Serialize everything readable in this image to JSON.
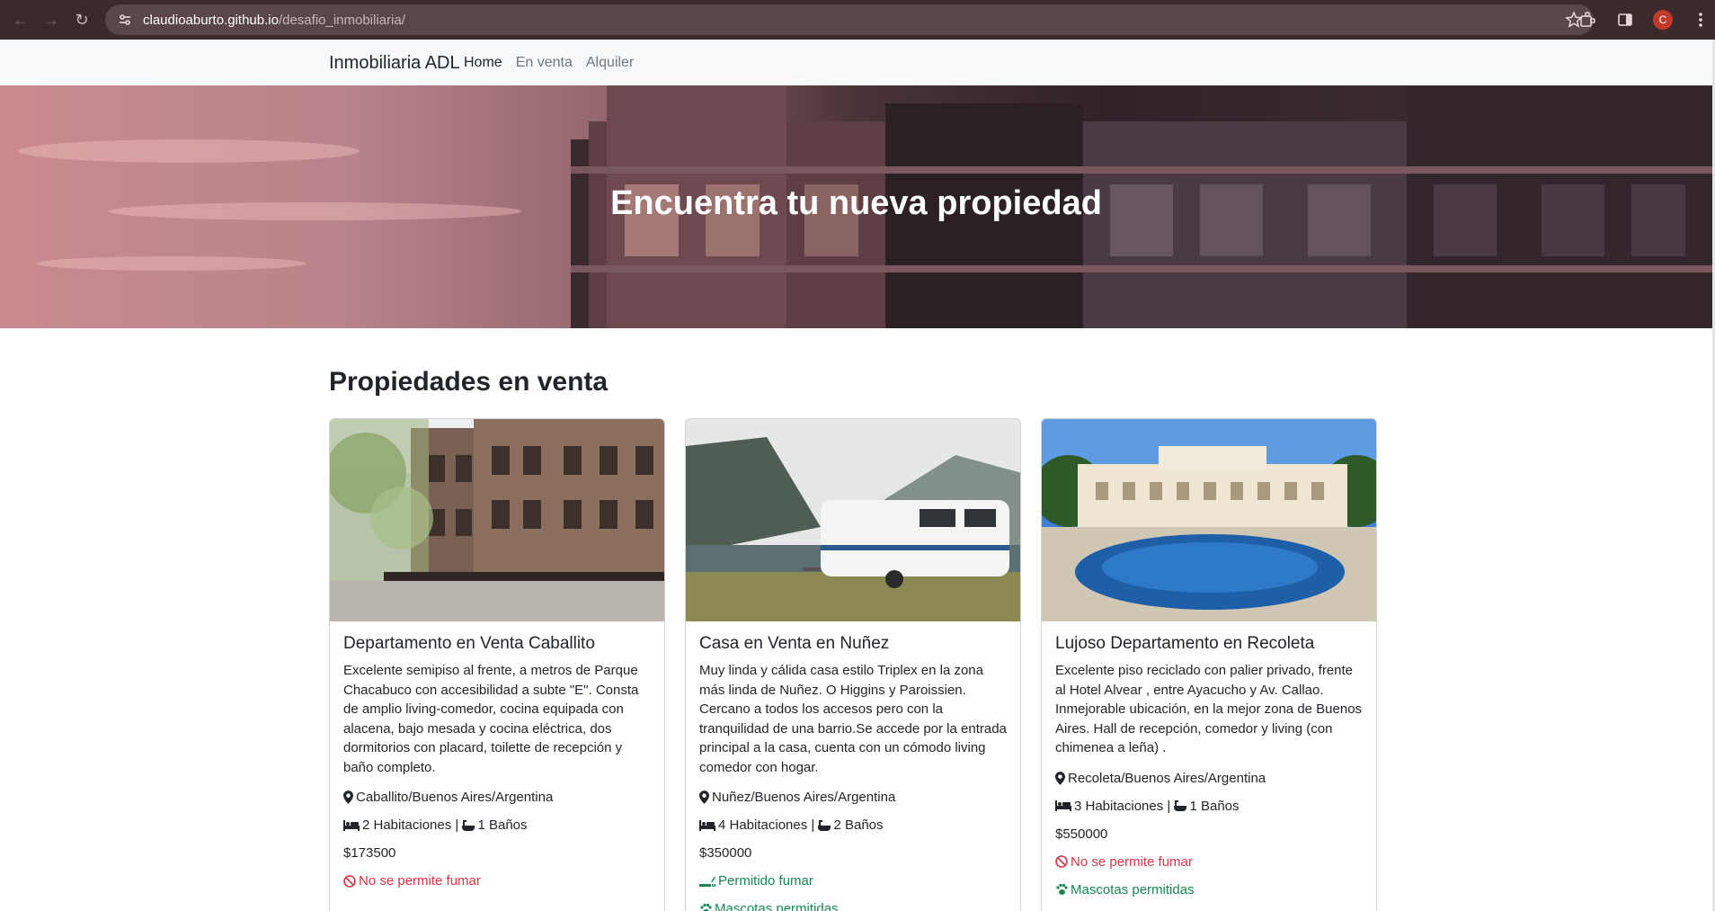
{
  "browser": {
    "url_host": "claudioaburto.github.io",
    "url_path": "/desafio_inmobiliaria/",
    "profile_initial": "C"
  },
  "navbar": {
    "brand": "Inmobiliaria ADL",
    "links": [
      "Home",
      "En venta",
      "Alquiler"
    ]
  },
  "hero": {
    "title": "Encuentra tu nueva propiedad"
  },
  "section": {
    "title": "Propiedades en venta"
  },
  "cards": [
    {
      "title": "Departamento en Venta Caballito",
      "description": "Excelente semipiso al frente, a metros de Parque Chacabuco con accesibilidad a subte \"E\". Consta de amplio living-comedor, cocina equipada con alacena, bajo mesada y cocina eléctrica, dos dormitorios con placard, toilette de recepción y baño completo.",
      "location": "Caballito/Buenos Aires/Argentina",
      "rooms": "2 Habitaciones | ",
      "baths": "1 Baños",
      "price": "$173500",
      "smoking": "No se permite fumar",
      "smoking_allowed": false
    },
    {
      "title": "Casa en Venta en Nuñez",
      "description": "Muy linda y cálida casa estilo Triplex en la zona más linda de Nuñez. O Higgins y Paroissien. Cercano a todos los accesos pero con la tranquilidad de una barrio.Se accede por la entrada principal a la casa, cuenta con un cómodo living comedor con hogar.",
      "location": "Nuñez/Buenos Aires/Argentina",
      "rooms": "4 Habitaciones | ",
      "baths": "2 Baños",
      "price": "$350000",
      "smoking": "Permitido fumar",
      "smoking_allowed": true,
      "pets": "Mascotas permitidas"
    },
    {
      "title": "Lujoso Departamento en Recoleta",
      "description": "Excelente piso reciclado con palier privado, frente al Hotel Alvear , entre Ayacucho y Av. Callao. Inmejorable ubicación, en la mejor zona de Buenos Aires. Hall de recepción, comedor y living (con chimenea a leña) .",
      "location": "Recoleta/Buenos Aires/Argentina",
      "rooms": "3 Habitaciones | ",
      "baths": "1 Baños",
      "price": "$550000",
      "smoking": "No se permite fumar",
      "smoking_allowed": false,
      "pets": "Mascotas permitidas"
    }
  ],
  "colors": {
    "danger": "#dc3545",
    "success": "#198754"
  }
}
